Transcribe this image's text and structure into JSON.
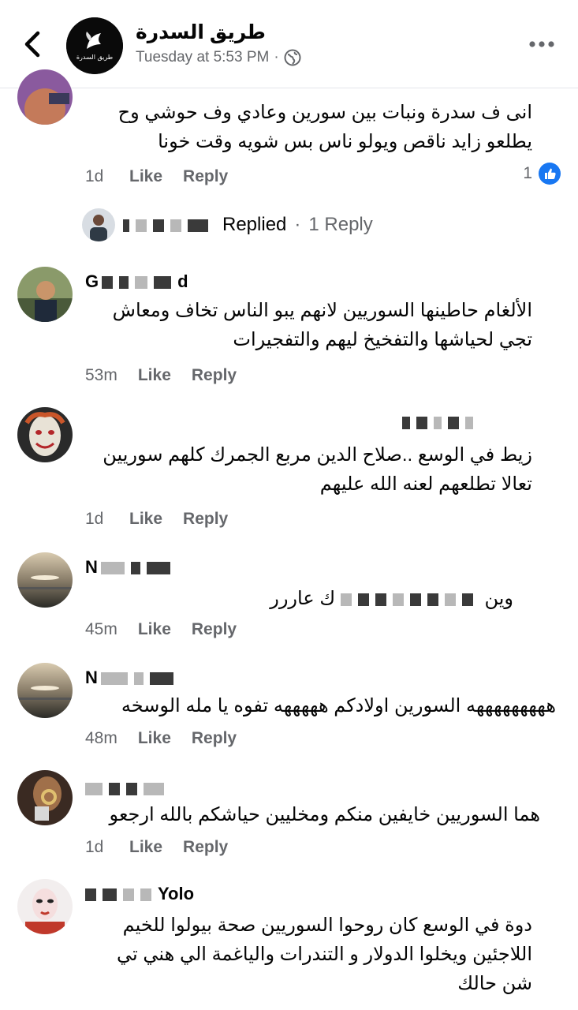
{
  "header": {
    "page_name": "طريق السدرة",
    "timestamp": "Tuesday at 5:53 PM",
    "separator": "·",
    "avatar_text": "طريق السدرة"
  },
  "comments": [
    {
      "text_lines": [
        "انى ف سدرة ونبات بين سورين وعادي وف حوشي وح",
        "يطلعو زايد ناقص ويولو ناس بس شويه وقت خونا"
      ],
      "time": "1d",
      "like": "Like",
      "reply": "Reply",
      "reaction_count": "1"
    },
    {
      "name_visible": "Gd",
      "text_lines": [
        "الألغام حاطينها السوريين لانهم يبو الناس تخاف ومعاش",
        "تجي لحياشها والتفخيخ ليهم والتفجيرات"
      ],
      "time": "53m",
      "like": "Like",
      "reply": "Reply"
    },
    {
      "text_lines": [
        "زيط في الوسع ..صلاح الدين مربع الجمرك كلهم سوريين",
        "تعالا تطلعهم لعنه الله عليهم"
      ],
      "time": "1d",
      "like": "Like",
      "reply": "Reply"
    },
    {
      "name_visible": "N",
      "text_lines": [
        "وين",
        "ك عاررر"
      ],
      "time": "45m",
      "like": "Like",
      "reply": "Reply"
    },
    {
      "name_visible": "N",
      "text_lines": [
        "هههههههههه السورين  اولادكم   هههههه تفوه يا مله الوسخه"
      ],
      "time": "48m",
      "like": "Like",
      "reply": "Reply"
    },
    {
      "text_lines": [
        "هما السوريين خايفين منكم ومخليين حياشكم بالله ارجعو"
      ],
      "time": "1d",
      "like": "Like",
      "reply": "Reply"
    },
    {
      "name_visible": "Yolo",
      "text_lines": [
        "دوة في الوسع كان روحوا السوريين صحة بيولوا للخيم",
        "اللاجئين ويخلوا الدولار و التندرات والياغمة الي هني تي",
        "شن حالك"
      ]
    }
  ],
  "replied": {
    "label": "Replied",
    "separator": "·",
    "count_label": "1 Reply"
  },
  "colors": {
    "accent": "#1877f2",
    "secondary_text": "#65676b",
    "divider": "#e4e6eb"
  }
}
